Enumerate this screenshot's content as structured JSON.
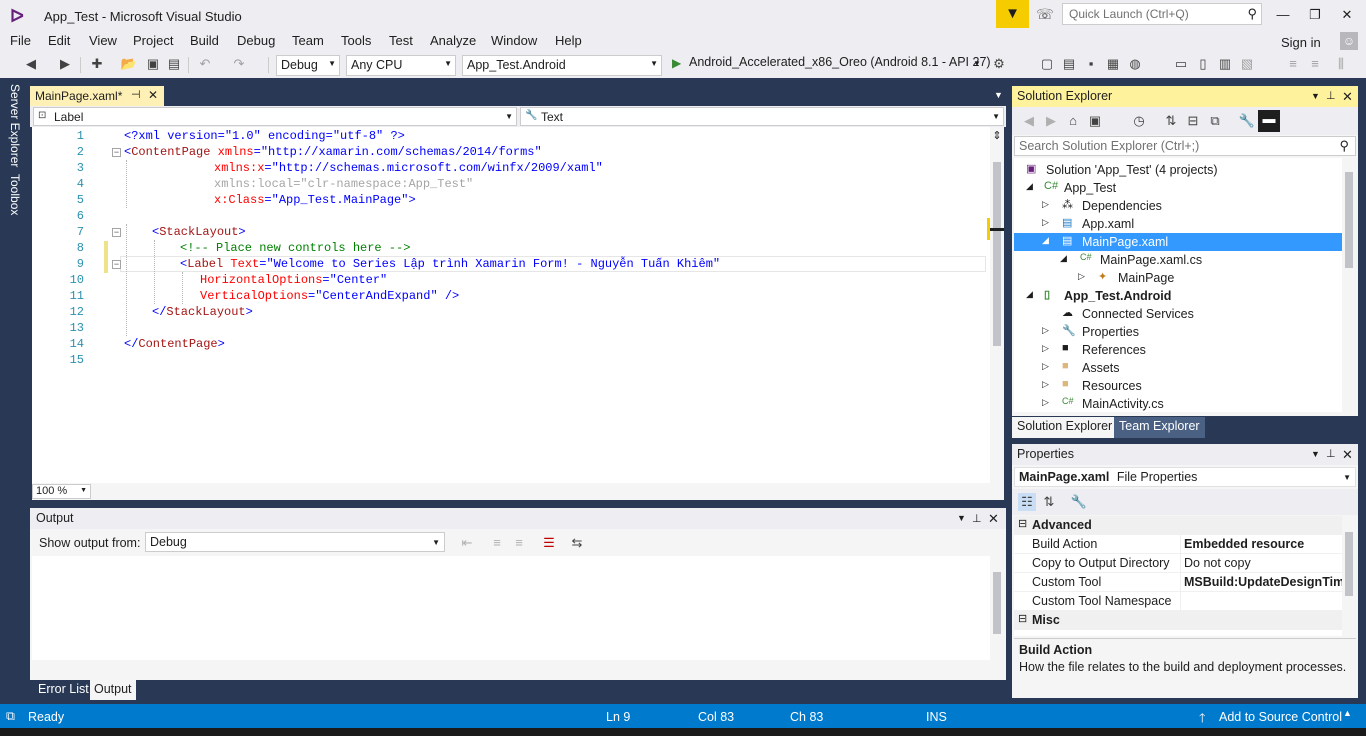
{
  "window": {
    "title": "App_Test - Microsoft Visual Studio",
    "quick_launch_placeholder": "Quick Launch (Ctrl+Q)",
    "sign_in": "Sign in"
  },
  "menu": [
    "File",
    "Edit",
    "View",
    "Project",
    "Build",
    "Debug",
    "Team",
    "Tools",
    "Test",
    "Analyze",
    "Window",
    "Help"
  ],
  "toolbar": {
    "configuration": "Debug",
    "platform": "Any CPU",
    "startup_project": "App_Test.Android",
    "run_target": "Android_Accelerated_x86_Oreo (Android 8.1 - API 27)"
  },
  "side_tabs": [
    "Server Explorer",
    "Toolbox"
  ],
  "editor": {
    "tab_label": "MainPage.xaml*",
    "nav_left": "Label",
    "nav_right": "Text",
    "zoom": "100 %",
    "lines": [
      "1",
      "2",
      "3",
      "4",
      "5",
      "6",
      "7",
      "8",
      "9",
      "10",
      "11",
      "12",
      "13",
      "14",
      "15"
    ],
    "code": {
      "l1_decl": "<?xml version=\"1.0\" encoding=\"utf-8\" ?>",
      "l2_open": "<",
      "l2_tag": "ContentPage",
      "l2_attr": " xmlns",
      "l2_eq": "=",
      "l2_val": "\"http://xamarin.com/schemas/2014/forms\"",
      "l3_attr": "xmlns:x",
      "l3_val": "\"http://schemas.microsoft.com/winfx/2009/xaml\"",
      "l4_attr": "xmlns:local",
      "l4_val": "\"clr-namespace:App_Test\"",
      "l5_attr": "x:Class",
      "l5_val": "\"App_Test.MainPage\"",
      "l5_close": ">",
      "l7_open": "<",
      "l7_tag": "StackLayout",
      "l7_close": ">",
      "l8_comment": "<!-- Place new controls here -->",
      "l9_open": "<",
      "l9_tag": "Label",
      "l9_attr": " Text",
      "l9_val": "\"Welcome to Series Lập trình Xamarin Form! - Nguyễn Tuấn Khiêm\"",
      "l10_attr": "HorizontalOptions",
      "l10_val": "\"Center\"",
      "l11_attr": "VerticalOptions",
      "l11_val": "\"CenterAndExpand\"",
      "l11_close": " />",
      "l12_open": "</",
      "l12_tag": "StackLayout",
      "l12_close": ">",
      "l14_open": "</",
      "l14_tag": "ContentPage",
      "l14_close": ">",
      "eq": "="
    }
  },
  "output": {
    "title": "Output",
    "show_from_label": "Show output from:",
    "source": "Debug",
    "tabs": [
      "Error List",
      "Output"
    ]
  },
  "solution_explorer": {
    "title": "Solution Explorer",
    "search_placeholder": "Search Solution Explorer (Ctrl+;)",
    "items": [
      {
        "label": "Solution 'App_Test' (4 projects)",
        "icon": "solution-icon"
      },
      {
        "label": "App_Test",
        "icon": "csharp-project-icon"
      },
      {
        "label": "Dependencies",
        "icon": "dependencies-icon"
      },
      {
        "label": "App.xaml",
        "icon": "xaml-file-icon"
      },
      {
        "label": "MainPage.xaml",
        "icon": "xaml-file-icon"
      },
      {
        "label": "MainPage.xaml.cs",
        "icon": "csharp-file-icon"
      },
      {
        "label": "MainPage",
        "icon": "class-icon"
      },
      {
        "label": "App_Test.Android",
        "icon": "android-project-icon"
      },
      {
        "label": "Connected Services",
        "icon": "connected-services-icon"
      },
      {
        "label": "Properties",
        "icon": "wrench-icon"
      },
      {
        "label": "References",
        "icon": "references-icon"
      },
      {
        "label": "Assets",
        "icon": "folder-icon"
      },
      {
        "label": "Resources",
        "icon": "folder-icon"
      },
      {
        "label": "MainActivity.cs",
        "icon": "csharp-file-icon"
      }
    ],
    "tabs": [
      "Solution Explorer",
      "Team Explorer"
    ]
  },
  "properties": {
    "title": "Properties",
    "object_name": "MainPage.xaml",
    "object_type": "File Properties",
    "categories": {
      "advanced": "Advanced",
      "misc": "Misc"
    },
    "rows": [
      {
        "name": "Build Action",
        "value": "Embedded resource"
      },
      {
        "name": "Copy to Output Directory",
        "value": "Do not copy"
      },
      {
        "name": "Custom Tool",
        "value": "MSBuild:UpdateDesignTimeXaml"
      },
      {
        "name": "Custom Tool Namespace",
        "value": ""
      }
    ],
    "desc_title": "Build Action",
    "desc_text": "How the file relates to the build and deployment processes."
  },
  "status": {
    "ready": "Ready",
    "ln": "Ln 9",
    "col": "Col 83",
    "ch": "Ch 83",
    "mode": "INS",
    "source_control": "Add to Source Control"
  },
  "colors": {
    "accent": "#007acc",
    "selection": "#3399ff",
    "tab_active": "#fff1b5",
    "filter_badge": "#f5cc00"
  }
}
